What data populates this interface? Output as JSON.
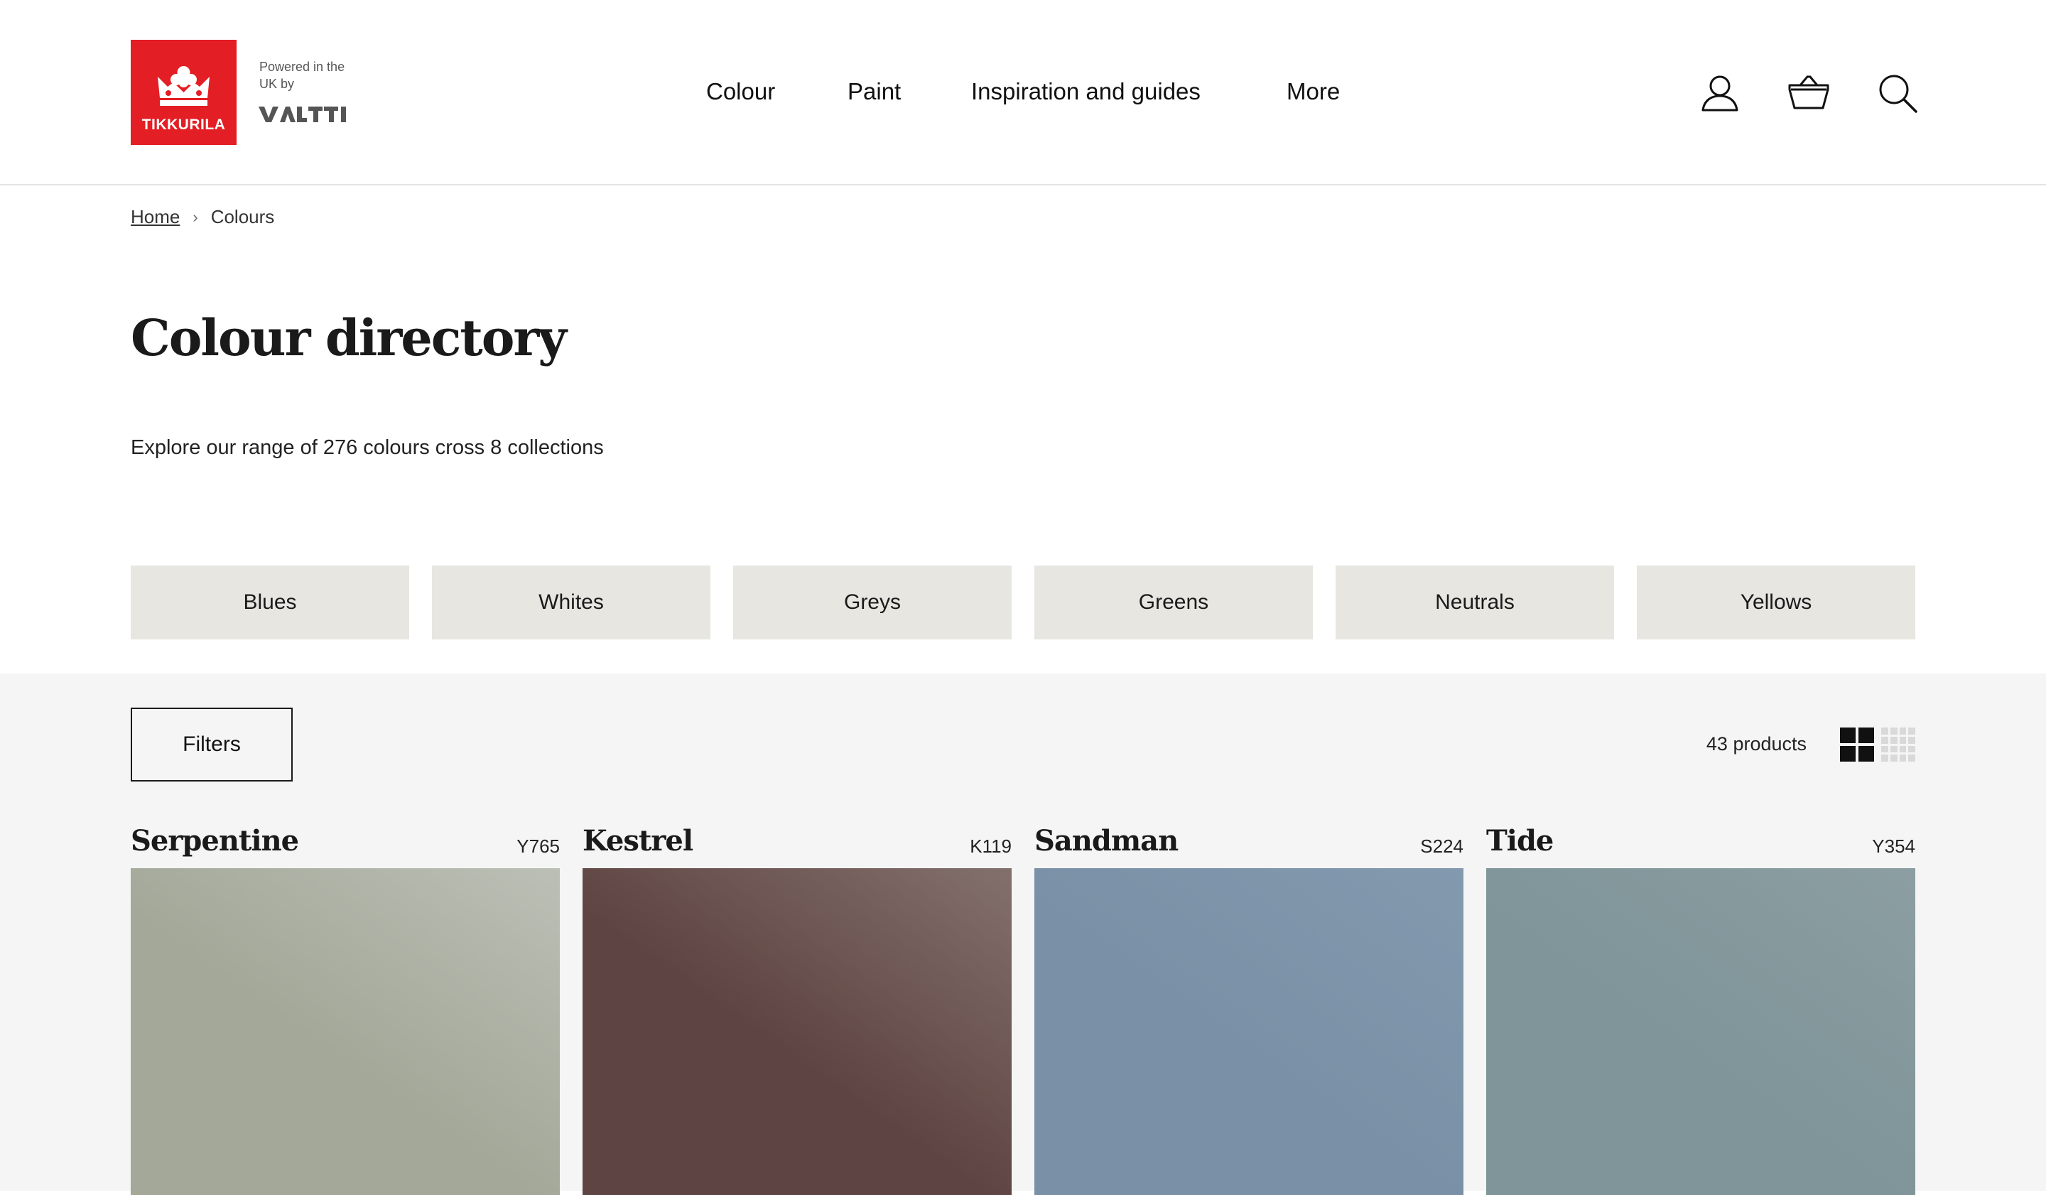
{
  "header": {
    "logo_text": "TIKKURILA",
    "powered_by": "Powered in the UK by",
    "partner_logo": "VALTTI",
    "nav": [
      "Colour",
      "Paint",
      "Inspiration and guides",
      "More"
    ],
    "icons": [
      "account-icon",
      "basket-icon",
      "search-icon"
    ]
  },
  "breadcrumb": {
    "home": "Home",
    "current": "Colours"
  },
  "page": {
    "title": "Colour directory",
    "intro": "Explore our range of 276 colours cross 8 collections"
  },
  "categories": [
    "Blues",
    "Whites",
    "Greys",
    "Greens",
    "Neutrals",
    "Yellows"
  ],
  "listing": {
    "filters_label": "Filters",
    "count_label": "43 products",
    "products": [
      {
        "name": "Serpentine",
        "code": "Y765",
        "color": "#a3a899",
        "highlight": "#bcbfb5"
      },
      {
        "name": "Kestrel",
        "code": "K119",
        "color": "#5e4442",
        "highlight": "#83706c"
      },
      {
        "name": "Sandman",
        "code": "S224",
        "color": "#7a90a6",
        "highlight": "#8399ae"
      },
      {
        "name": "Tide",
        "code": "Y354",
        "color": "#7f9599",
        "highlight": "#8c9ea2"
      }
    ]
  },
  "colors": {
    "brand_red": "#e31e24",
    "category_bg": "#e7e6e1",
    "listing_bg": "#f5f5f5"
  }
}
